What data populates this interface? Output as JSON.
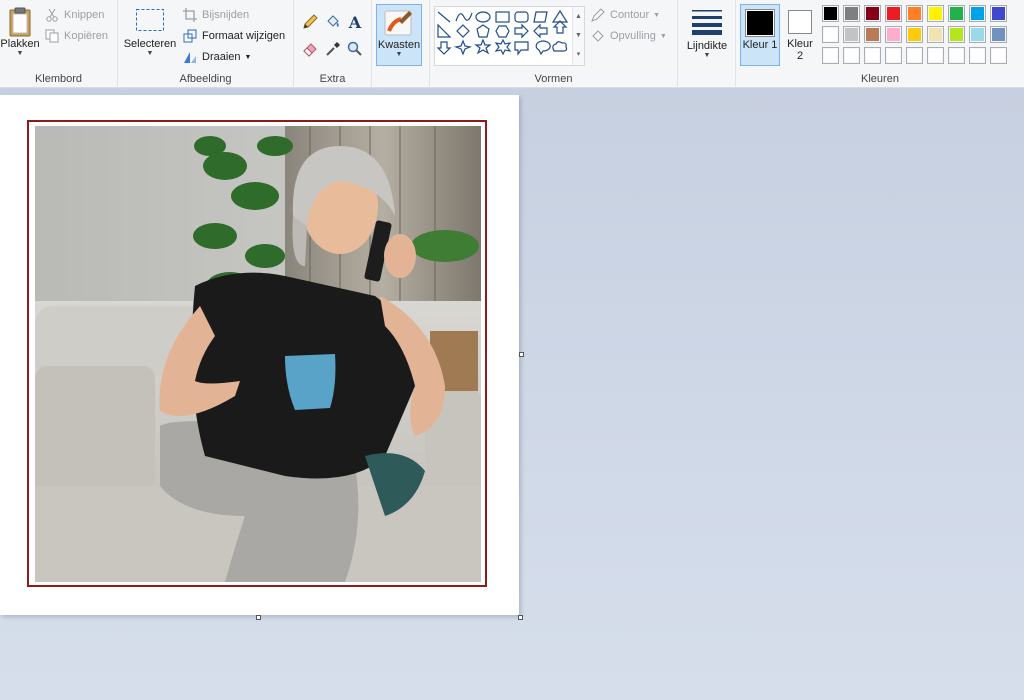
{
  "ribbon": {
    "clipboard": {
      "label": "Klembord",
      "paste": "Plakken",
      "cut": "Knippen",
      "copy": "Kopiëren"
    },
    "image": {
      "label": "Afbeelding",
      "select": "Selecteren",
      "crop": "Bijsnijden",
      "resize": "Formaat wijzigen",
      "rotate": "Draaien"
    },
    "tools": {
      "label": "Extra",
      "text_glyph": "A"
    },
    "brushes": {
      "label": "Kwasten"
    },
    "shapes": {
      "label": "Vormen",
      "outline": "Contour",
      "fill": "Opvulling"
    },
    "size": {
      "label": "Lijndikte"
    },
    "colors": {
      "label": "Kleuren",
      "color1": "Kleur 1",
      "color2": "Kleur 2",
      "color1_value": "#000000",
      "color2_value": "#ffffff",
      "palette_row1": [
        "#000000",
        "#7f7f7f",
        "#880015",
        "#ed1c24",
        "#ff7f27",
        "#fff200",
        "#22b14c",
        "#00a2e8",
        "#3f48cc",
        "#a349a4"
      ],
      "palette_row2": [
        "#ffffff",
        "#c3c3c3",
        "#b97a57",
        "#ffaec9",
        "#ffc90e",
        "#efe4b0",
        "#b5e61d",
        "#99d9ea",
        "#7092be",
        "#c8bfe7"
      ],
      "palette_row3": [
        "#ffffff",
        "#ffffff",
        "#ffffff",
        "#ffffff",
        "#ffffff",
        "#ffffff",
        "#ffffff",
        "#ffffff",
        "#ffffff",
        "#ffffff"
      ]
    }
  },
  "canvas": {
    "frame_color": "#8b1c1c",
    "photo_alt": "Vrouw op bank aan de telefoon met blauwe mok"
  }
}
